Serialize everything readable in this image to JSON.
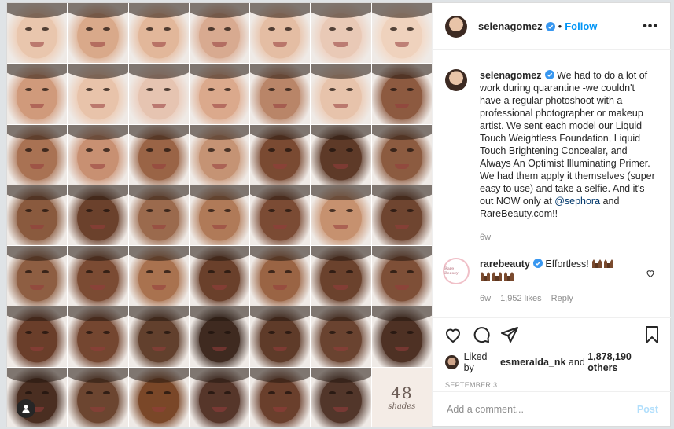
{
  "post": {
    "username": "selenagomez",
    "follow_label": "Follow",
    "dot": "•",
    "more": "•••"
  },
  "media": {
    "grid_rows": 7,
    "grid_cols": 7,
    "shades_number": "48",
    "shades_word": "shades",
    "skin_tones": [
      "#e9c6ad",
      "#d9a98a",
      "#e2b79a",
      "#d8aa90",
      "#e4bda3",
      "#e9c9b6",
      "#efd2bd",
      "#d09a7b",
      "#e8c3aa",
      "#e6c4b1",
      "#dba98c",
      "#b98568",
      "#e7c3ab",
      "#8d5a40",
      "#a97253",
      "#c89072",
      "#9a6446",
      "#c59374",
      "#7a4a32",
      "#5e3a28",
      "#8c5b40",
      "#8a5a3e",
      "#6b412c",
      "#9b6a4d",
      "#b07a58",
      "#7b4b34",
      "#c6916f",
      "#6f4530",
      "#8e5e42",
      "#7b4b33",
      "#a9724f",
      "#6a402b",
      "#9a6444",
      "#6b422d",
      "#7e4f37",
      "#6a3e2a",
      "#744630",
      "#62402d",
      "#3f2a20",
      "#5f3b29",
      "#6a4330",
      "#4e3124",
      "#4a2e21",
      "#6c4530",
      "#7a4728",
      "#56362a",
      "#6a3f2c",
      "#52362a",
      "#f4ece6"
    ],
    "accent": "#0095f6"
  },
  "caption": {
    "username": "selenagomez",
    "text_before": "We had to do a lot of work during quarantine -we couldn't have a regular photoshoot with a professional photographer or makeup artist. We sent each model our Liquid Touch Weightless Foundation, Liquid Touch Brightening Concealer, and Always An Optimist Illuminating Primer. We had them apply it themselves (super easy to use) and take a selfie. And it's out NOW only at ",
    "mention": "@sephora",
    "text_after": " and RareBeauty.com!!",
    "age": "6w"
  },
  "reply": {
    "avatar_text": "Rare Beauty",
    "username": "rarebeauty",
    "text": "Effortless!",
    "age": "6w",
    "likes": "1,952 likes",
    "reply_label": "Reply"
  },
  "actions": {
    "liked_by_prefix": "Liked by",
    "liked_by_user": "esmeralda_nk",
    "liked_by_mid": "and",
    "liked_by_count": "1,878,190 others",
    "date": "SEPTEMBER 3"
  },
  "comment_box": {
    "placeholder": "Add a comment...",
    "post_label": "Post"
  }
}
